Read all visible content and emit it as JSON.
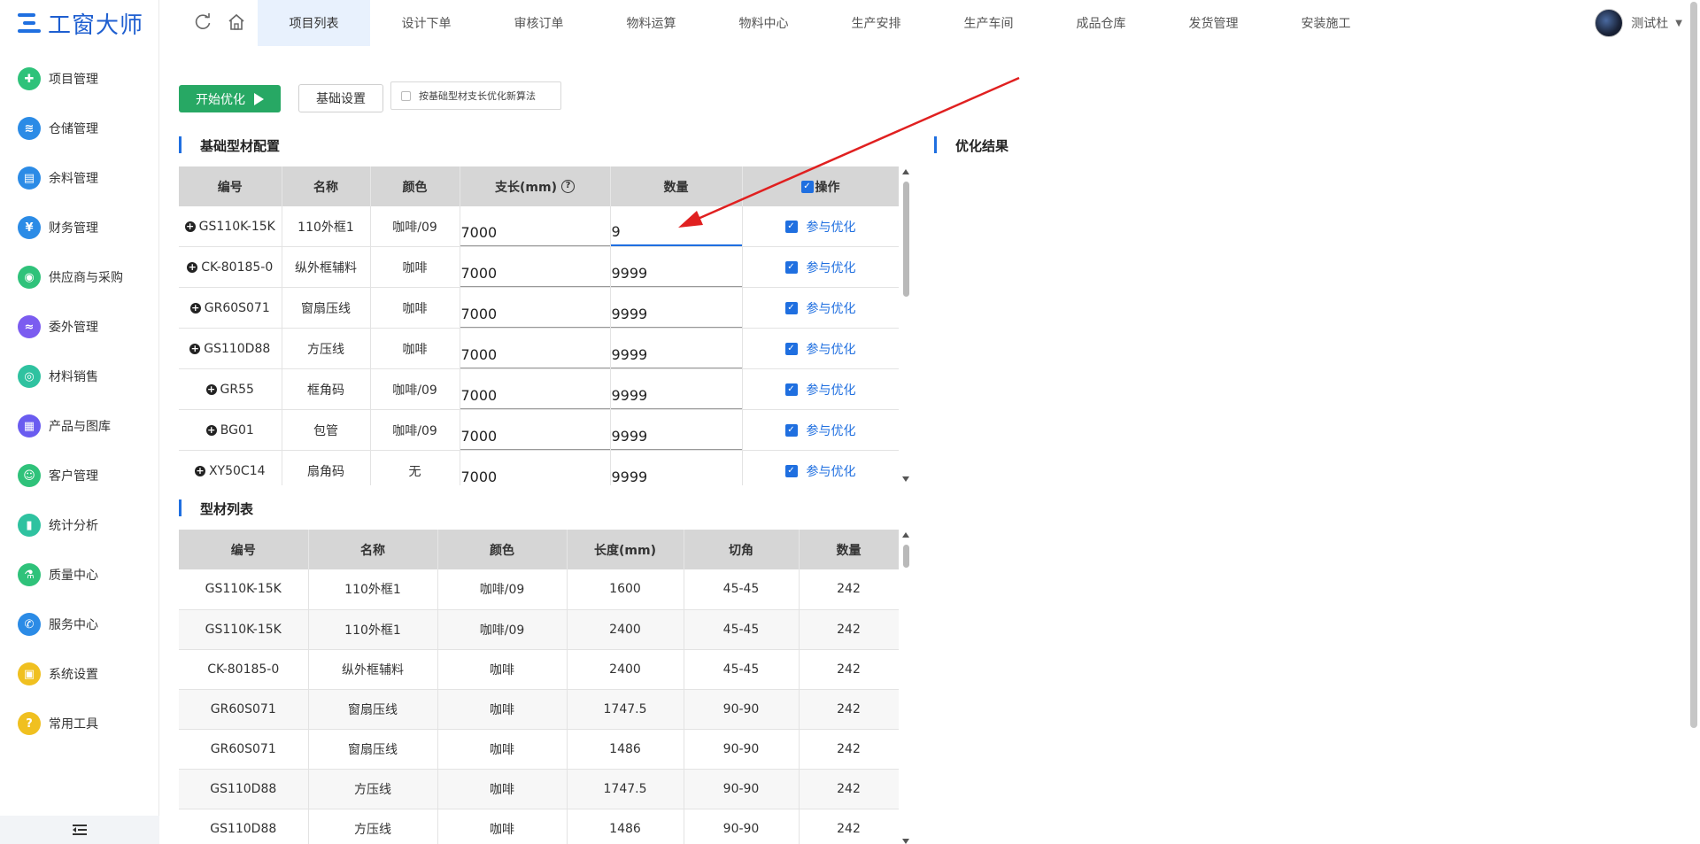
{
  "app": {
    "logo_text": "工窗大师"
  },
  "sidebar": {
    "items": [
      {
        "label": "项目管理",
        "icon": "puzzle-icon",
        "color": "#2fc27a",
        "glyph": "✚"
      },
      {
        "label": "仓储管理",
        "icon": "layers-icon",
        "color": "#2b8be6",
        "glyph": "≋"
      },
      {
        "label": "余料管理",
        "icon": "box-icon",
        "color": "#2b8be6",
        "glyph": "▤"
      },
      {
        "label": "财务管理",
        "icon": "finance-icon",
        "color": "#2b8be6",
        "glyph": "¥"
      },
      {
        "label": "供应商与采购",
        "icon": "supplier-icon",
        "color": "#2fc27a",
        "glyph": "◉"
      },
      {
        "label": "委外管理",
        "icon": "outsource-icon",
        "color": "#7b5cf0",
        "glyph": "≈"
      },
      {
        "label": "材料销售",
        "icon": "sales-icon",
        "color": "#2fc2a0",
        "glyph": "◎"
      },
      {
        "label": "产品与图库",
        "icon": "gallery-icon",
        "color": "#6a5cf0",
        "glyph": "▦"
      },
      {
        "label": "客户管理",
        "icon": "customer-icon",
        "color": "#2fc27a",
        "glyph": "☺"
      },
      {
        "label": "统计分析",
        "icon": "chart-icon",
        "color": "#2fc2a0",
        "glyph": "▮"
      },
      {
        "label": "质量中心",
        "icon": "flask-icon",
        "color": "#2fc27a",
        "glyph": "⚗"
      },
      {
        "label": "服务中心",
        "icon": "phone-icon",
        "color": "#2b8be6",
        "glyph": "✆"
      },
      {
        "label": "系统设置",
        "icon": "settings-icon",
        "color": "#f0c020",
        "glyph": "▣"
      },
      {
        "label": "常用工具",
        "icon": "tools-icon",
        "color": "#f0c020",
        "glyph": "?"
      }
    ]
  },
  "topbar": {
    "tabs": [
      "项目列表",
      "设计下单",
      "审核订单",
      "物料运算",
      "物料中心",
      "生产安排",
      "生产车间",
      "成品仓库",
      "发货管理",
      "安装施工"
    ],
    "active_tab": 0,
    "user_name": "测试杜"
  },
  "toolbar": {
    "start_label": "开始优化",
    "settings_label": "基础设置",
    "algo_label": "按基础型材支长优化新算法"
  },
  "config_section": {
    "title": "基础型材配置",
    "headers": [
      "编号",
      "名称",
      "颜色",
      "支长(mm)",
      "数量",
      "操作"
    ],
    "rows": [
      {
        "code": "GS110K-15K",
        "name": "110外框1",
        "color": "咖啡/09",
        "length": "7000",
        "qty": "9",
        "op": "参与优化"
      },
      {
        "code": "CK-80185-0",
        "name": "纵外框辅料",
        "color": "咖啡",
        "length": "7000",
        "qty": "9999",
        "op": "参与优化"
      },
      {
        "code": "GR60S071",
        "name": "窗扇压线",
        "color": "咖啡",
        "length": "7000",
        "qty": "9999",
        "op": "参与优化"
      },
      {
        "code": "GS110D88",
        "name": "方压线",
        "color": "咖啡",
        "length": "7000",
        "qty": "9999",
        "op": "参与优化"
      },
      {
        "code": "GR55",
        "name": "框角码",
        "color": "咖啡/09",
        "length": "7000",
        "qty": "9999",
        "op": "参与优化"
      },
      {
        "code": "BG01",
        "name": "包管",
        "color": "咖啡/09",
        "length": "7000",
        "qty": "9999",
        "op": "参与优化"
      },
      {
        "code": "XY50C14",
        "name": "扇角码",
        "color": "无",
        "length": "7000",
        "qty": "9999",
        "op": "参与优化"
      }
    ]
  },
  "profile_section": {
    "title": "型材列表",
    "headers": [
      "编号",
      "名称",
      "颜色",
      "长度(mm)",
      "切角",
      "数量"
    ],
    "rows": [
      [
        "GS110K-15K",
        "110外框1",
        "咖啡/09",
        "1600",
        "45-45",
        "242"
      ],
      [
        "GS110K-15K",
        "110外框1",
        "咖啡/09",
        "2400",
        "45-45",
        "242"
      ],
      [
        "CK-80185-0",
        "纵外框辅料",
        "咖啡",
        "2400",
        "45-45",
        "242"
      ],
      [
        "GR60S071",
        "窗扇压线",
        "咖啡",
        "1747.5",
        "90-90",
        "242"
      ],
      [
        "GR60S071",
        "窗扇压线",
        "咖啡",
        "1486",
        "90-90",
        "242"
      ],
      [
        "GS110D88",
        "方压线",
        "咖啡",
        "1747.5",
        "90-90",
        "242"
      ],
      [
        "GS110D88",
        "方压线",
        "咖啡",
        "1486",
        "90-90",
        "242"
      ]
    ]
  },
  "result_section": {
    "title": "优化结果"
  },
  "colors": {
    "accent": "#1f6fe0",
    "start_button": "#27a864",
    "annotation": "#e02020"
  }
}
